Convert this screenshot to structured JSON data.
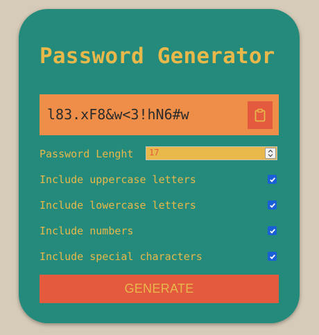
{
  "app": {
    "title": "Password Generator"
  },
  "result": {
    "password": "l83.xF8&w<3!hN6#w",
    "copy_icon": "clipboard-icon"
  },
  "options": {
    "length_label": "Password Lenght",
    "length_value": "17",
    "uppercase_label": "Include uppercase letters",
    "uppercase_checked": true,
    "lowercase_label": "Include lowercase letters",
    "lowercase_checked": true,
    "numbers_label": "Include numbers",
    "numbers_checked": true,
    "special_label": "Include special characters",
    "special_checked": true
  },
  "actions": {
    "generate_label": "GENERATE"
  },
  "colors": {
    "background": "#d6cbb8",
    "card": "#248b7c",
    "accent_yellow": "#e8b84a",
    "result_orange": "#ee8e48",
    "button_red": "#e35a3e",
    "checkbox_blue": "#1a5fd6"
  }
}
